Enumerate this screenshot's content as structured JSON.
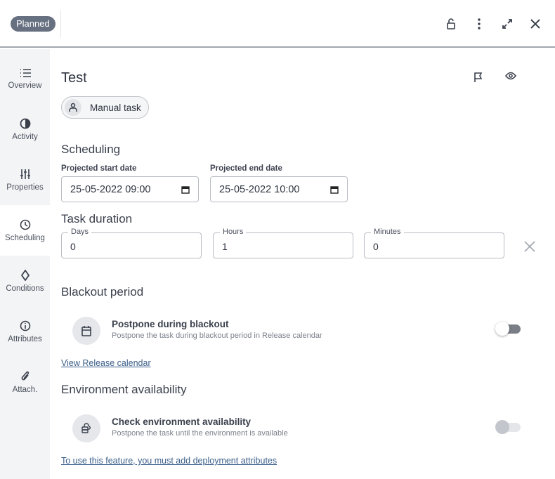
{
  "header": {
    "status": "Planned"
  },
  "sidebar": {
    "items": [
      {
        "label": "Overview",
        "icon": "list-icon"
      },
      {
        "label": "Activity",
        "icon": "activity-icon"
      },
      {
        "label": "Properties",
        "icon": "sliders-icon"
      },
      {
        "label": "Scheduling",
        "icon": "clock-icon",
        "active": true
      },
      {
        "label": "Conditions",
        "icon": "diamond-icon"
      },
      {
        "label": "Attributes",
        "icon": "info-icon"
      },
      {
        "label": "Attach.",
        "icon": "paperclip-icon"
      }
    ]
  },
  "task": {
    "title": "Test",
    "type": "Manual task"
  },
  "scheduling": {
    "heading": "Scheduling",
    "start_label": "Projected start date",
    "start_value": "25-05-2022 09:00",
    "end_label": "Projected end date",
    "end_value": "25-05-2022 10:00"
  },
  "duration": {
    "heading": "Task duration",
    "days_label": "Days",
    "days": "0",
    "hours_label": "Hours",
    "hours": "1",
    "minutes_label": "Minutes",
    "minutes": "0"
  },
  "blackout": {
    "heading": "Blackout period",
    "title": "Postpone during blackout",
    "subtitle": "Postpone the task during blackout period in Release calendar",
    "enabled": false,
    "link": "View Release calendar"
  },
  "environment": {
    "heading": "Environment availability",
    "title": "Check environment availability",
    "subtitle": "Postpone the task until the environment is available",
    "enabled": false,
    "link": "To use this feature, you must add deployment attributes"
  }
}
